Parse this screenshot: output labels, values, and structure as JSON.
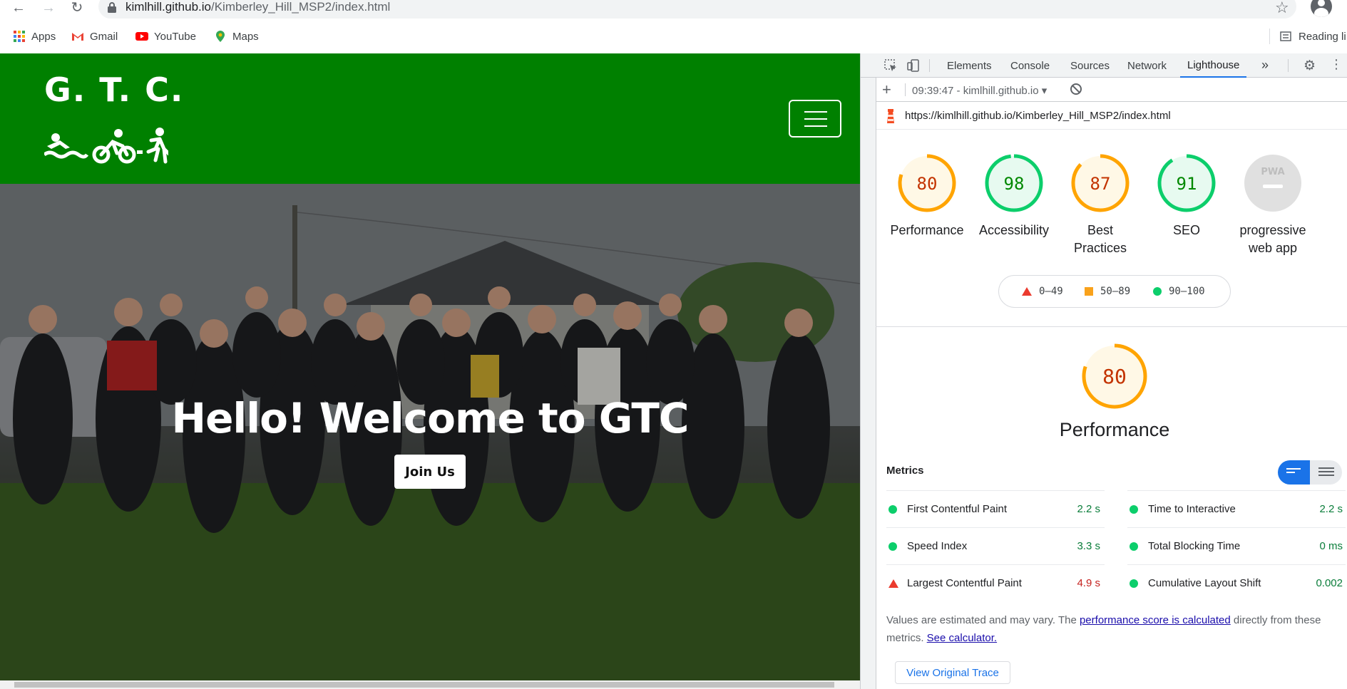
{
  "browser": {
    "url_host": "kimlhill.github.io",
    "url_path": "/Kimberley_Hill_MSP2/index.html",
    "bookmarks": [
      "Apps",
      "Gmail",
      "YouTube",
      "Maps"
    ],
    "reading_list": "Reading li"
  },
  "site": {
    "brand": "G. T. C.",
    "hero_heading": "Hello! Welcome to GTC",
    "join_label": "Join Us",
    "colors": {
      "header_bg": "#008000"
    }
  },
  "devtools": {
    "tabs": [
      "Elements",
      "Console",
      "Sources",
      "Network",
      "Lighthouse"
    ],
    "active_tab": "Lighthouse",
    "session": "09:39:47 - kimlhill.github.io",
    "report_url": "https://kimlhill.github.io/Kimberley_Hill_MSP2/index.html",
    "gauges": [
      {
        "score": "80",
        "value": 80,
        "label": "Performance",
        "status": "average"
      },
      {
        "score": "98",
        "value": 98,
        "label": "Accessibility",
        "status": "pass"
      },
      {
        "score": "87",
        "value": 87,
        "label": "Best Practices",
        "status": "average"
      },
      {
        "score": "91",
        "value": 91,
        "label": "SEO",
        "status": "pass"
      },
      {
        "score": "PWA",
        "value": 0,
        "label": "progressive web app",
        "status": "na"
      }
    ],
    "legend": [
      "0–49",
      "50–89",
      "90–100"
    ],
    "performance": {
      "score": "80",
      "value": 80,
      "label": "Performance"
    },
    "metrics_title": "Metrics",
    "metrics": [
      {
        "name": "First Contentful Paint",
        "value": "2.2 s",
        "status": "good"
      },
      {
        "name": "Time to Interactive",
        "value": "2.2 s",
        "status": "good"
      },
      {
        "name": "Speed Index",
        "value": "3.3 s",
        "status": "good"
      },
      {
        "name": "Total Blocking Time",
        "value": "0 ms",
        "status": "good"
      },
      {
        "name": "Largest Contentful Paint",
        "value": "4.9 s",
        "status": "bad"
      },
      {
        "name": "Cumulative Layout Shift",
        "value": "0.002",
        "status": "good"
      }
    ],
    "note": {
      "part1": "Values are estimated and may vary. The ",
      "link1": "performance score is calculated",
      "part2": " directly from these metrics. ",
      "link2": "See calculator."
    },
    "trace_button": "View Original Trace",
    "colors": {
      "pass": "#0cce6b",
      "average": "#ffa400",
      "fail": "#ff4e42",
      "accent": "#1a73e8"
    }
  }
}
